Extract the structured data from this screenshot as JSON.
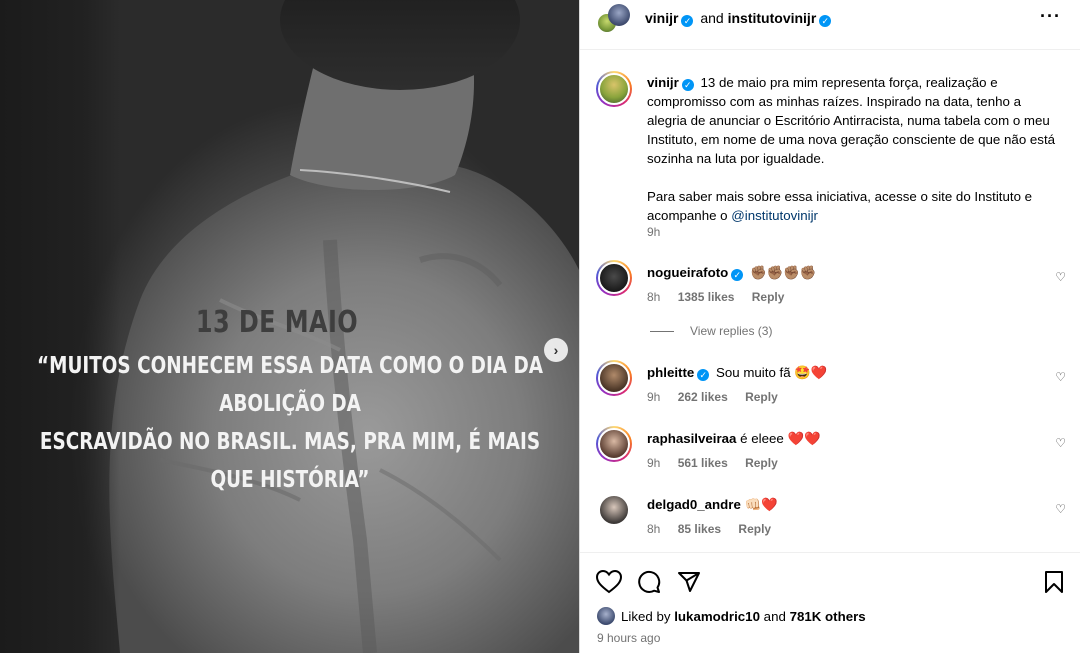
{
  "media": {
    "overlay_date": "13 DE MAIO",
    "overlay_quote_line1": "“MUITOS CONHECEM ESSA DATA COMO O DIA DA ABOLIÇÃO DA",
    "overlay_quote_line2": "ESCRAVIDÃO NO BRASIL. MAS, PRA MIM, É MAIS QUE HISTÓRIA”",
    "next_icon": "chevron-right-icon"
  },
  "header": {
    "author": "vinijr",
    "and_text": "and",
    "coauthor": "institutovinijr",
    "more_icon": "more-horizontal-icon"
  },
  "caption": {
    "username": "vinijr",
    "paragraph1": "13 de maio pra mim representa força, realização e compromisso com as minhas raízes. Inspirado na data, tenho a alegria de anunciar o Escritório Antirracista, numa tabela com o meu Instituto, em nome de uma nova geração consciente de que não está sozinha na luta por igualdade.",
    "paragraph2_text": "Para saber mais sobre essa iniciativa, acesse o site do Instituto e acompanhe o",
    "paragraph2_link": "@institutovinijr",
    "time": "9h"
  },
  "comments": [
    {
      "username": "nogueirafoto",
      "verified": true,
      "text": "✊🏽✊🏽✊🏽✊🏽",
      "time": "8h",
      "likes": "1385 likes",
      "reply": "Reply"
    },
    {
      "username": "phleitte",
      "verified": true,
      "text": "Sou muito fã 🤩❤️",
      "time": "9h",
      "likes": "262 likes",
      "reply": "Reply"
    },
    {
      "username": "raphasilveiraa",
      "verified": false,
      "text": "é eleee ❤️❤️",
      "time": "9h",
      "likes": "561 likes",
      "reply": "Reply"
    },
    {
      "username": "delgad0_andre",
      "verified": false,
      "text": "👊🏻❤️",
      "time": "8h",
      "likes": "85 likes",
      "reply": "Reply"
    }
  ],
  "view_replies": "View replies (3)",
  "likes": {
    "prefix": "Liked by",
    "user": "lukamodric10",
    "and_text": "and",
    "others": "781K others"
  },
  "posted_ago": "9 hours ago"
}
